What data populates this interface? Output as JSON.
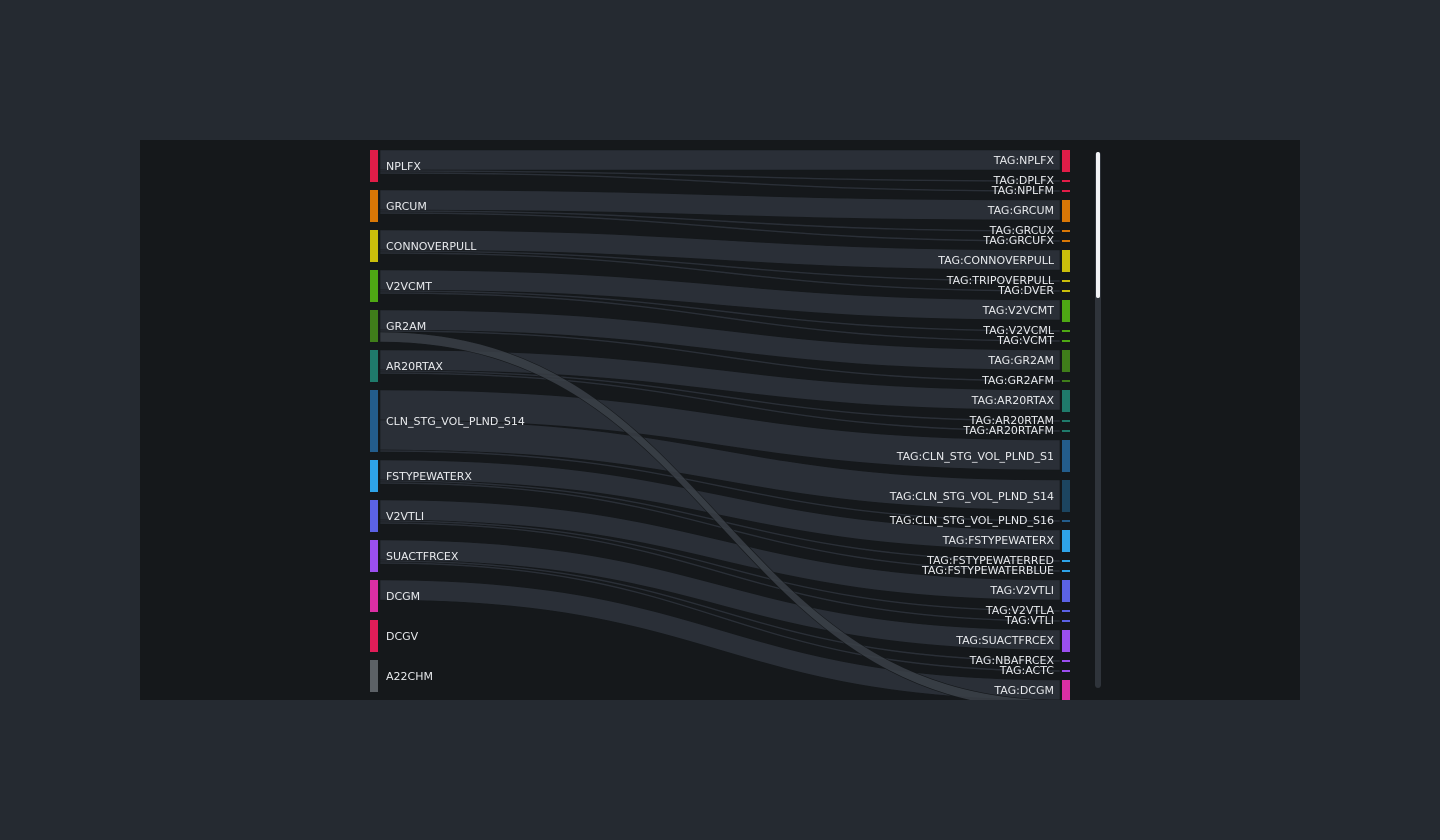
{
  "sources": [
    {
      "label": "NPLFX",
      "color": "#e11d48"
    },
    {
      "label": "GRCUM",
      "color": "#d97706"
    },
    {
      "label": "CONNOVERPULL",
      "color": "#cabd0b"
    },
    {
      "label": "V2VCMT",
      "color": "#4ea814"
    },
    {
      "label": "GR2AM",
      "color": "#3f7d1a"
    },
    {
      "label": "AR20RTAX",
      "color": "#1f7a6b"
    },
    {
      "label": "CLN_STG_VOL_PLND_S14",
      "color": "#235d8c"
    },
    {
      "label": "FSTYPEWATERX",
      "color": "#2ea3e8"
    },
    {
      "label": "V2VTLI",
      "color": "#5b62e6"
    },
    {
      "label": "SUACTFRCEX",
      "color": "#9b4ff0"
    },
    {
      "label": "DCGM",
      "color": "#db2fa4"
    },
    {
      "label": "DCGV",
      "color": "#e11d58"
    },
    {
      "label": "A22CHM",
      "color": "#5c6166"
    }
  ],
  "targets": [
    {
      "label": "TAG:NPLFX",
      "color": "#e11d48",
      "weight": "major"
    },
    {
      "label": "TAG:DPLFX",
      "color": "#e11d48",
      "weight": "minor"
    },
    {
      "label": "TAG:NPLFM",
      "color": "#e11d48",
      "weight": "minor"
    },
    {
      "label": "TAG:GRCUM",
      "color": "#d97706",
      "weight": "major"
    },
    {
      "label": "TAG:GRCUX",
      "color": "#d97706",
      "weight": "minor"
    },
    {
      "label": "TAG:GRCUFX",
      "color": "#d97706",
      "weight": "minor"
    },
    {
      "label": "TAG:CONNOVERPULL",
      "color": "#cabd0b",
      "weight": "major"
    },
    {
      "label": "TAG:TRIPOVERPULL",
      "color": "#cabd0b",
      "weight": "minor"
    },
    {
      "label": "TAG:DVER",
      "color": "#cabd0b",
      "weight": "minor"
    },
    {
      "label": "TAG:V2VCMT",
      "color": "#4ea814",
      "weight": "major"
    },
    {
      "label": "TAG:V2VCML",
      "color": "#4ea814",
      "weight": "minor"
    },
    {
      "label": "TAG:VCMT",
      "color": "#4ea814",
      "weight": "minor"
    },
    {
      "label": "TAG:GR2AM",
      "color": "#3f7d1a",
      "weight": "major"
    },
    {
      "label": "TAG:GR2AFM",
      "color": "#3f7d1a",
      "weight": "minor"
    },
    {
      "label": "TAG:AR20RTAX",
      "color": "#1f7a6b",
      "weight": "major"
    },
    {
      "label": "TAG:AR20RTAM",
      "color": "#1f7a6b",
      "weight": "minor"
    },
    {
      "label": "TAG:AR20RTAFM",
      "color": "#1f7a6b",
      "weight": "minor"
    },
    {
      "label": "TAG:CLN_STG_VOL_PLND_S1",
      "color": "#235d8c",
      "weight": "major"
    },
    {
      "label": "TAG:CLN_STG_VOL_PLND_S14",
      "color": "#1c4560",
      "weight": "major"
    },
    {
      "label": "TAG:CLN_STG_VOL_PLND_S16",
      "color": "#235d8c",
      "weight": "minor"
    },
    {
      "label": "TAG:FSTYPEWATERX",
      "color": "#2ea3e8",
      "weight": "major"
    },
    {
      "label": "TAG:FSTYPEWATERRED",
      "color": "#2ea3e8",
      "weight": "minor"
    },
    {
      "label": "TAG:FSTYPEWATERBLUE",
      "color": "#2ea3e8",
      "weight": "minor"
    },
    {
      "label": "TAG:V2VTLI",
      "color": "#5b62e6",
      "weight": "major"
    },
    {
      "label": "TAG:V2VTLA",
      "color": "#5b62e6",
      "weight": "minor"
    },
    {
      "label": "TAG:VTLI",
      "color": "#5b62e6",
      "weight": "minor"
    },
    {
      "label": "TAG:SUACTFRCEX",
      "color": "#9b4ff0",
      "weight": "major"
    },
    {
      "label": "TAG:NBAFRCEX",
      "color": "#9b4ff0",
      "weight": "minor"
    },
    {
      "label": "TAG:ACTC",
      "color": "#9b4ff0",
      "weight": "minor"
    },
    {
      "label": "TAG:DCGM",
      "color": "#db2fa4",
      "weight": "major"
    }
  ],
  "links": [
    {
      "source": "NPLFX",
      "target": "TAG:NPLFX"
    },
    {
      "source": "NPLFX",
      "target": "TAG:DPLFX"
    },
    {
      "source": "NPLFX",
      "target": "TAG:NPLFM"
    },
    {
      "source": "GRCUM",
      "target": "TAG:GRCUM"
    },
    {
      "source": "GRCUM",
      "target": "TAG:GRCUX"
    },
    {
      "source": "GRCUM",
      "target": "TAG:GRCUFX"
    },
    {
      "source": "CONNOVERPULL",
      "target": "TAG:CONNOVERPULL"
    },
    {
      "source": "CONNOVERPULL",
      "target": "TAG:TRIPOVERPULL"
    },
    {
      "source": "CONNOVERPULL",
      "target": "TAG:DVER"
    },
    {
      "source": "V2VCMT",
      "target": "TAG:V2VCMT"
    },
    {
      "source": "V2VCMT",
      "target": "TAG:V2VCML"
    },
    {
      "source": "V2VCMT",
      "target": "TAG:VCMT"
    },
    {
      "source": "GR2AM",
      "target": "TAG:GR2AM"
    },
    {
      "source": "GR2AM",
      "target": "TAG:GR2AFM"
    },
    {
      "source": "AR20RTAX",
      "target": "TAG:AR20RTAX"
    },
    {
      "source": "AR20RTAX",
      "target": "TAG:AR20RTAM"
    },
    {
      "source": "AR20RTAX",
      "target": "TAG:AR20RTAFM"
    },
    {
      "source": "CLN_STG_VOL_PLND_S14",
      "target": "TAG:CLN_STG_VOL_PLND_S1"
    },
    {
      "source": "CLN_STG_VOL_PLND_S14",
      "target": "TAG:CLN_STG_VOL_PLND_S14"
    },
    {
      "source": "CLN_STG_VOL_PLND_S14",
      "target": "TAG:CLN_STG_VOL_PLND_S16"
    },
    {
      "source": "FSTYPEWATERX",
      "target": "TAG:FSTYPEWATERX"
    },
    {
      "source": "FSTYPEWATERX",
      "target": "TAG:FSTYPEWATERRED"
    },
    {
      "source": "FSTYPEWATERX",
      "target": "TAG:FSTYPEWATERBLUE"
    },
    {
      "source": "V2VTLI",
      "target": "TAG:V2VTLI"
    },
    {
      "source": "V2VTLI",
      "target": "TAG:V2VTLA"
    },
    {
      "source": "V2VTLI",
      "target": "TAG:VTLI"
    },
    {
      "source": "SUACTFRCEX",
      "target": "TAG:SUACTFRCEX"
    },
    {
      "source": "SUACTFRCEX",
      "target": "TAG:NBAFRCEX"
    },
    {
      "source": "SUACTFRCEX",
      "target": "TAG:ACTC"
    },
    {
      "source": "DCGM",
      "target": "TAG:DCGM"
    },
    {
      "source": "GR2AM",
      "target": "TAG:DCGM"
    }
  ],
  "colors": {
    "page_background": "#252a31",
    "panel_background": "#15181b",
    "link_fill": "#2a2f37",
    "link_highlight": "#3a3f47",
    "label_text": "#e8eaed",
    "scrollbar_track": "#2f343b",
    "scrollbar_thumb": "#f2f3f5"
  }
}
